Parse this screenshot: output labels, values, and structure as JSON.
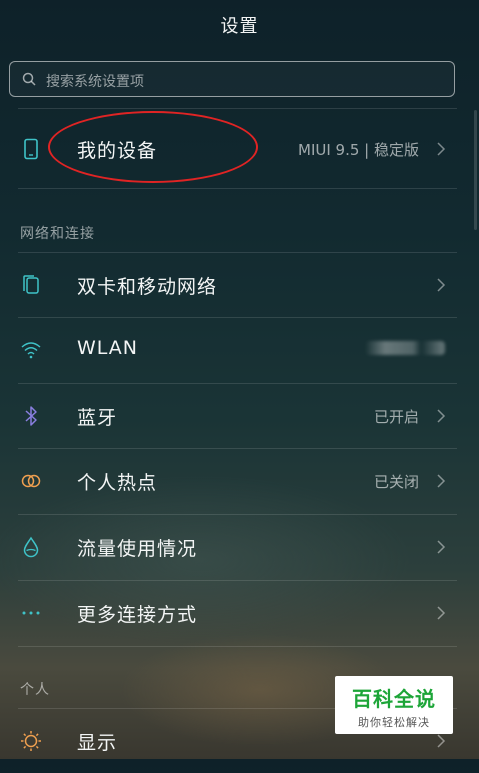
{
  "header": {
    "title": "设置"
  },
  "search": {
    "placeholder": "搜索系统设置项"
  },
  "my_device": {
    "label": "我的设备",
    "value": "MIUI 9.5 | 稳定版"
  },
  "sections": {
    "network": "网络和连接",
    "personal": "个人"
  },
  "network_items": [
    {
      "label": "双卡和移动网络",
      "value": "",
      "icon": "dual-sim-icon"
    },
    {
      "label": "WLAN",
      "value": "",
      "icon": "wifi-icon"
    },
    {
      "label": "蓝牙",
      "value": "已开启",
      "icon": "bluetooth-icon"
    },
    {
      "label": "个人热点",
      "value": "已关闭",
      "icon": "hotspot-icon"
    },
    {
      "label": "流量使用情况",
      "value": "",
      "icon": "data-usage-icon"
    },
    {
      "label": "更多连接方式",
      "value": "",
      "icon": "more-connections-icon"
    }
  ],
  "personal_items": [
    {
      "label": "显示",
      "icon": "display-icon"
    }
  ],
  "watermark": {
    "title": "百科全说",
    "subtitle": "助你轻松解决"
  },
  "colors": {
    "annotation_oval": "#e02424",
    "icon_teal": "#3fc3c8",
    "icon_purple": "#8a7fe0",
    "icon_orange": "#f0a050",
    "watermark_green": "#1da538"
  }
}
